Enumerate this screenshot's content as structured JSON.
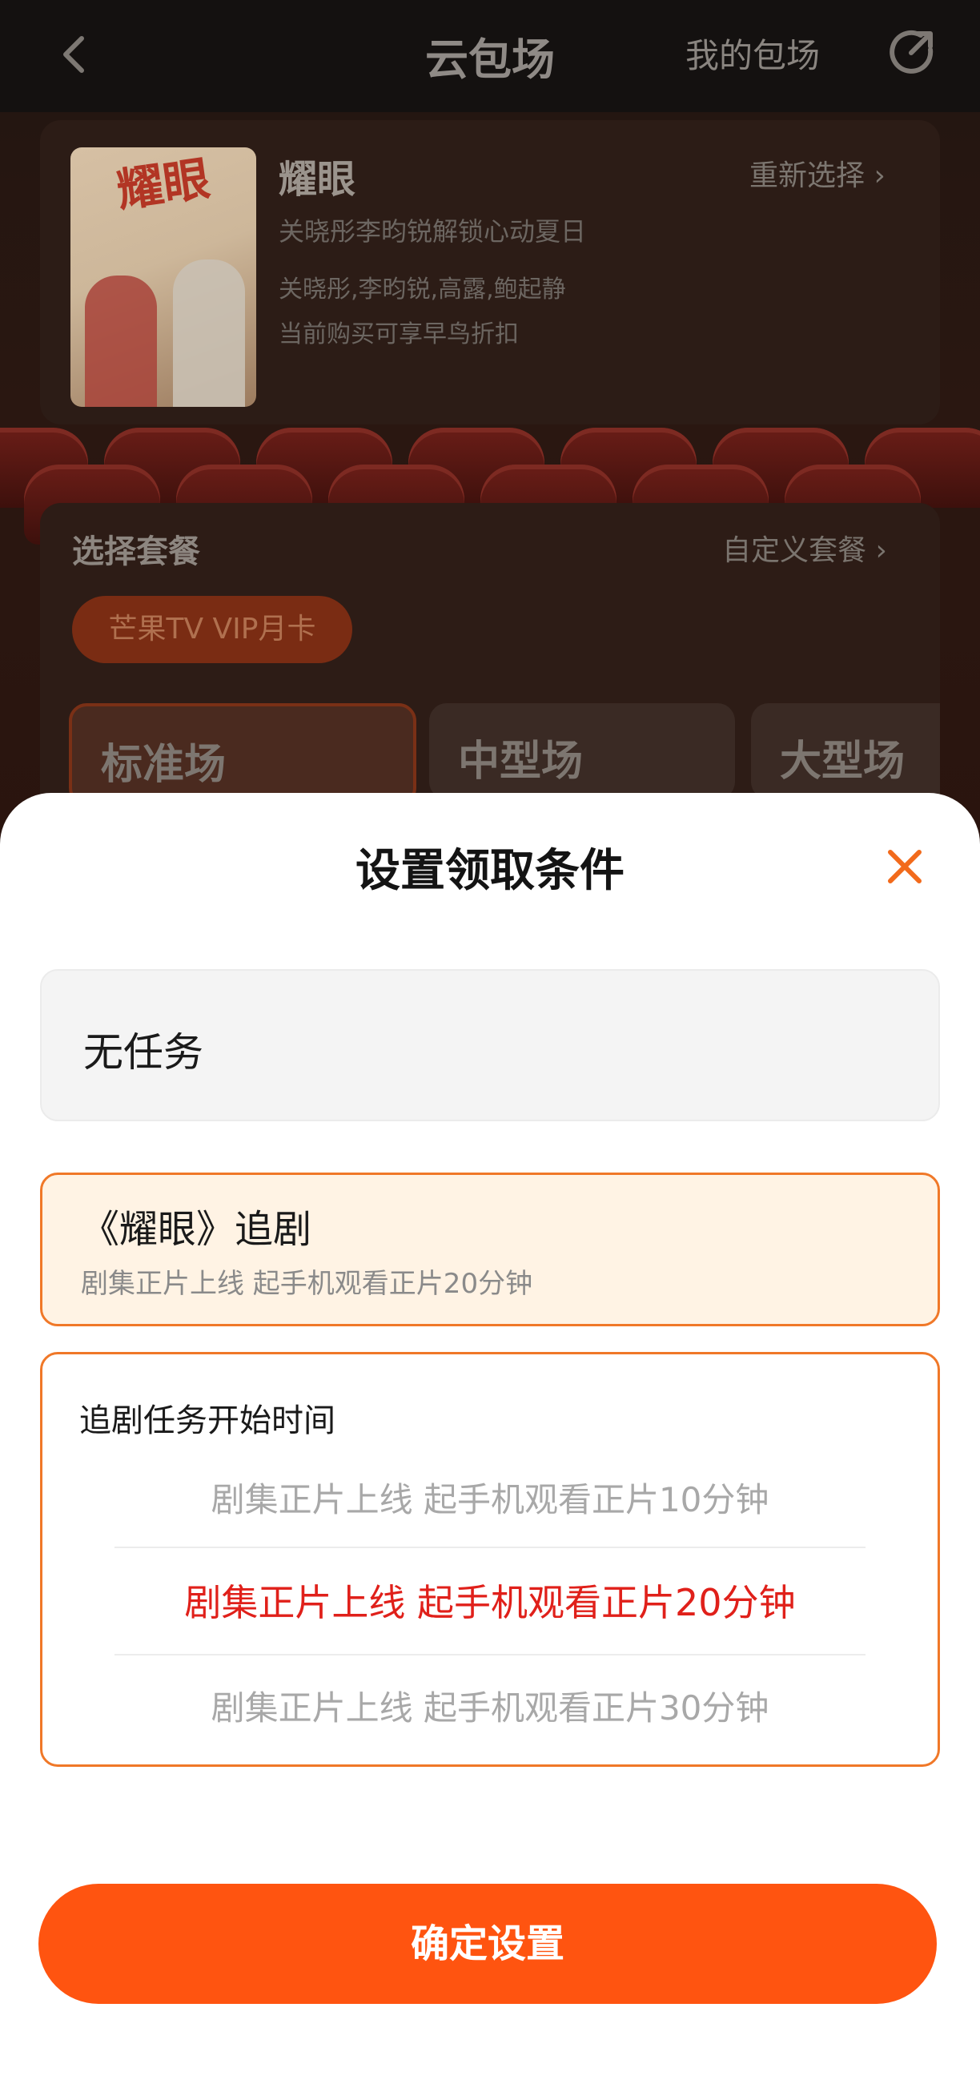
{
  "header": {
    "title": "云包场",
    "my_link": "我的包场"
  },
  "movie": {
    "poster_text": "耀眼",
    "name": "耀眼",
    "reselect": "重新选择 ›",
    "subtitle": "关晓彤李昀锐解锁心动夏日",
    "cast": "关晓彤,李昀锐,高露,鲍起静",
    "promo": "当前购买可享早鸟折扣"
  },
  "package": {
    "title": "选择套餐",
    "custom": "自定义套餐 ›",
    "chip": "芒果TV VIP月卡",
    "sizes": [
      "标准场",
      "中型场",
      "大型场"
    ]
  },
  "sheet": {
    "title": "设置领取条件",
    "option_none": "无任务",
    "option_drama": {
      "title": "《耀眼》追剧",
      "subtitle": "剧集正片上线 起手机观看正片20分钟"
    },
    "picker": {
      "title": "追剧任务开始时间",
      "items": [
        "剧集正片上线 起手机观看正片10分钟",
        "剧集正片上线 起手机观看正片20分钟",
        "剧集正片上线 起手机观看正片30分钟"
      ],
      "selected_index": 1
    },
    "confirm": "确定设置"
  },
  "colors": {
    "accent": "#ff5410",
    "border_orange": "#f07828",
    "selected_text": "#e0201a",
    "close_x": "#f26a1b"
  },
  "icons": [
    "back-arrow-icon",
    "share-icon",
    "close-icon"
  ]
}
